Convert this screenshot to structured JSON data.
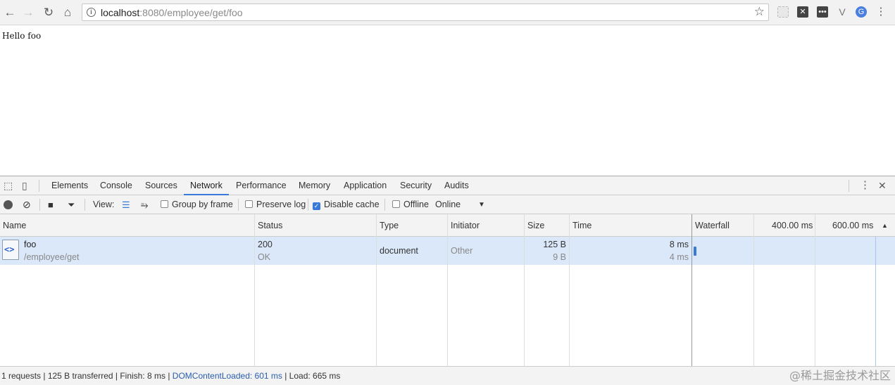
{
  "browser": {
    "url_host": "localhost",
    "url_rest": ":8080/employee/get/foo",
    "icons": [
      "back-arrow-icon",
      "forward-arrow-icon",
      "reload-icon",
      "home-icon",
      "info-icon",
      "star-icon",
      "extension-icons",
      "menu-icon"
    ]
  },
  "page": {
    "text": "Hello foo"
  },
  "devtools": {
    "tabs": [
      "Elements",
      "Console",
      "Sources",
      "Network",
      "Performance",
      "Memory",
      "Application",
      "Security",
      "Audits"
    ],
    "active_tab": "Network",
    "toolbar": {
      "view_label": "View:",
      "group_by_frame": "Group by frame",
      "preserve_log": "Preserve log",
      "disable_cache": "Disable cache",
      "disable_cache_checked": true,
      "offline": "Offline",
      "throttle": "Online"
    },
    "columns": {
      "name": "Name",
      "status": "Status",
      "type": "Type",
      "initiator": "Initiator",
      "size": "Size",
      "time": "Time",
      "waterfall": "Waterfall",
      "tick1": "400.00 ms",
      "tick2": "600.00 ms"
    },
    "request": {
      "name": "foo",
      "path": "/employee/get",
      "status": "200",
      "status_text": "OK",
      "type": "document",
      "initiator": "Other",
      "size": "125 B",
      "content": "9 B",
      "time": "8 ms",
      "latency": "4 ms"
    },
    "summary": {
      "part1": "1 requests | 125 B transferred | Finish: 8 ms | ",
      "domcontent": "DOMContentLoaded: 601 ms",
      "part2": " | Load: 665 ms"
    }
  },
  "watermark": "@稀土掘金技术社区",
  "colors": {
    "accent": "#3879d9",
    "selected_row": "#dbe8fa"
  }
}
